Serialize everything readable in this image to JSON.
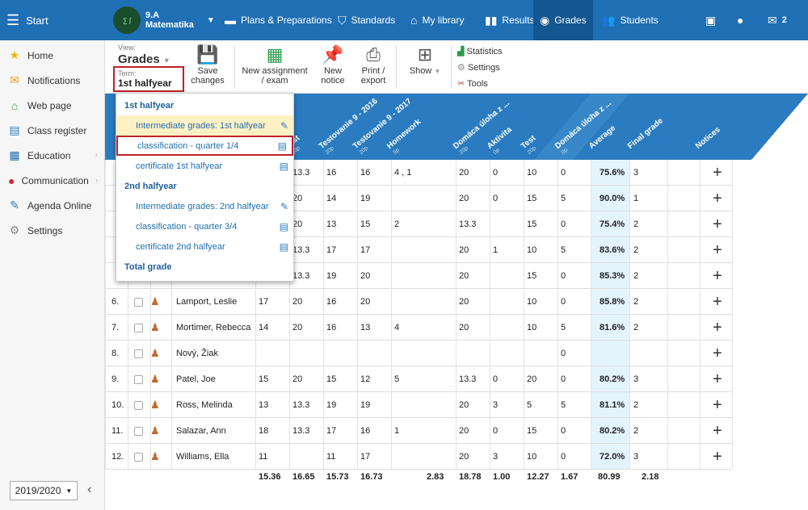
{
  "topbar": {
    "start": "Start",
    "class_line1": "9.A",
    "class_line2": "Matematika",
    "nav": [
      {
        "label": "Plans & Preparations",
        "icon": "briefcase-icon"
      },
      {
        "label": "Standards",
        "icon": "shield-icon"
      },
      {
        "label": "My library",
        "icon": "library-icon"
      },
      {
        "label": "Results",
        "icon": "bar-chart-icon"
      },
      {
        "label": "Grades",
        "icon": "grades-icon"
      },
      {
        "label": "Students",
        "icon": "students-icon"
      }
    ],
    "messages_count": "2"
  },
  "sidebar": {
    "items": [
      {
        "label": "Home",
        "icon": "star-icon"
      },
      {
        "label": "Notifications",
        "icon": "envelope-icon"
      },
      {
        "label": "Web page",
        "icon": "house-icon"
      },
      {
        "label": "Class register",
        "icon": "register-icon"
      },
      {
        "label": "Education",
        "icon": "education-icon"
      },
      {
        "label": "Communication",
        "icon": "chat-icon"
      },
      {
        "label": "Agenda Online",
        "icon": "pen-icon"
      },
      {
        "label": "Settings",
        "icon": "gear-icon"
      }
    ],
    "year": "2019/2020"
  },
  "toolbar": {
    "view_caption": "View:",
    "view_value": "Grades",
    "term_caption": "Term:",
    "term_value": "1st halfyear",
    "save": "Save changes",
    "new_assignment": "New assignment / exam",
    "new_notice": "New notice",
    "print": "Print / export",
    "show": "Show",
    "statistics": "Statistics",
    "settings": "Settings",
    "tools": "Tools"
  },
  "columns": [
    {
      "label": "...nie 9 - 2018",
      "sub": ""
    },
    {
      "label": "Test",
      "sub": "20p"
    },
    {
      "label": "Testovanie 9 - 2016",
      "sub": "20p"
    },
    {
      "label": "Testovanie 9 - 2017",
      "sub": "20p"
    },
    {
      "label": "Homework",
      "sub": "5p"
    },
    {
      "label": "Domáca úloha z ...",
      "sub": "20p"
    },
    {
      "label": "Aktivita",
      "sub": "0p"
    },
    {
      "label": "Test",
      "sub": "20p"
    },
    {
      "label": "Domáca úloha z ...",
      "sub": "0p"
    },
    {
      "label": "Average",
      "sub": ""
    },
    {
      "label": "Final grade",
      "sub": ""
    },
    {
      "label": "Notices",
      "sub": ""
    }
  ],
  "rows": [
    {
      "num": "",
      "name": "",
      "cells": [
        "13.3",
        "16",
        "16",
        "4 , 1",
        "20",
        "0",
        "10",
        "0"
      ],
      "avg": "75.6%",
      "final": "3"
    },
    {
      "num": "",
      "name": "",
      "cells": [
        "20",
        "14",
        "19",
        "",
        "20",
        "0",
        "15",
        "5"
      ],
      "avg": "90.0%",
      "final": "1"
    },
    {
      "num": "",
      "name": "",
      "cells": [
        "20",
        "13",
        "15",
        "2",
        "13.3",
        "",
        "15",
        "0"
      ],
      "avg": "75.4%",
      "final": "2"
    },
    {
      "num": "",
      "name": "",
      "cells": [
        "13.3",
        "17",
        "17",
        "",
        "20",
        "1",
        "10",
        "5"
      ],
      "avg": "83.6%",
      "final": "2"
    },
    {
      "num": "",
      "name": "",
      "cells": [
        "13.3",
        "19",
        "20",
        "",
        "20",
        "",
        "15",
        "0"
      ],
      "avg": "85.3%",
      "final": "2"
    },
    {
      "num": "6.",
      "name": "Lamport, Leslie",
      "c0": "17",
      "cells": [
        "20",
        "16",
        "20",
        "",
        "20",
        "",
        "10",
        "0"
      ],
      "avg": "85.8%",
      "final": "2"
    },
    {
      "num": "7.",
      "name": "Mortimer, Rebecca",
      "c0": "14",
      "cells": [
        "20",
        "16",
        "13",
        "4",
        "20",
        "",
        "10",
        "5"
      ],
      "avg": "81.6%",
      "final": "2"
    },
    {
      "num": "8.",
      "name": "Nový, Žiak",
      "c0": "",
      "cells": [
        "",
        "",
        "",
        "",
        "",
        "",
        "",
        "0"
      ],
      "avg": "",
      "final": ""
    },
    {
      "num": "9.",
      "name": "Patel, Joe",
      "c0": "15",
      "cells": [
        "20",
        "15",
        "12",
        "5",
        "13.3",
        "0",
        "20",
        "0"
      ],
      "avg": "80.2%",
      "final": "3"
    },
    {
      "num": "10.",
      "name": "Ross, Melinda",
      "c0": "13",
      "cells": [
        "13.3",
        "19",
        "19",
        "",
        "20",
        "3",
        "5",
        "5"
      ],
      "avg": "81.1%",
      "final": "2"
    },
    {
      "num": "11.",
      "name": "Salazar, Ann",
      "c0": "18",
      "cells": [
        "13.3",
        "17",
        "16",
        "1",
        "20",
        "0",
        "15",
        "0"
      ],
      "avg": "80.2%",
      "final": "2"
    },
    {
      "num": "12.",
      "name": "Williams, Ella",
      "c0": "11",
      "cells": [
        "",
        "11",
        "17",
        "",
        "20",
        "3",
        "10",
        "0"
      ],
      "avg": "72.0%",
      "final": "3"
    }
  ],
  "totals": [
    "15.36",
    "16.65",
    "15.73",
    "16.73",
    "2.83",
    "18.78",
    "1.00",
    "12.27",
    "1.67",
    "80.99",
    "2.18"
  ],
  "dropdown": {
    "items": [
      {
        "label": "1st halfyear",
        "type": "head"
      },
      {
        "label": "Intermediate grades: 1st halfyear",
        "type": "hl"
      },
      {
        "label": "classification - quarter 1/4",
        "type": "sel"
      },
      {
        "label": "certificate 1st halfyear",
        "type": "item"
      },
      {
        "label": "2nd halfyear",
        "type": "head"
      },
      {
        "label": "Intermediate grades: 2nd halfyear",
        "type": "item"
      },
      {
        "label": "classification - quarter 3/4",
        "type": "item"
      },
      {
        "label": "certificate 2nd halfyear",
        "type": "item"
      },
      {
        "label": "Total grade",
        "type": "head"
      }
    ]
  },
  "colors": {
    "topbar": "#1f6fb5",
    "header": "#2a7bc0",
    "accent_red": "#c0202a"
  }
}
